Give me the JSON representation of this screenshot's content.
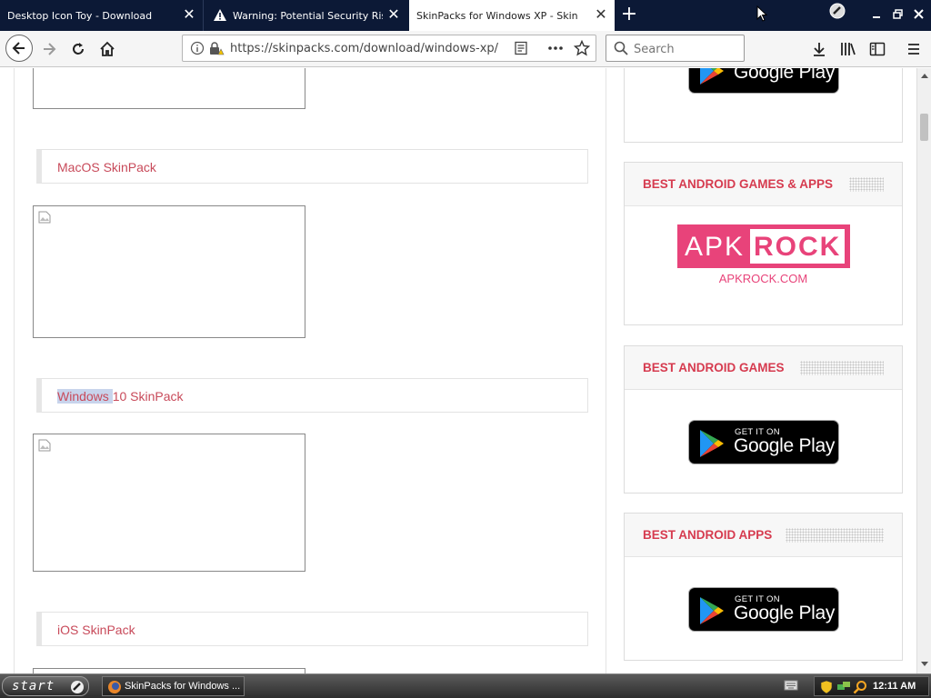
{
  "tabs": [
    {
      "label": "Desktop Icon Toy - Download",
      "active": false
    },
    {
      "label": "Warning: Potential Security Risk Ahead",
      "active": false
    },
    {
      "label": "SkinPacks for Windows XP - Skin Pack for Windows",
      "active": true
    }
  ],
  "nav": {
    "url": "https://skinpacks.com/download/windows-xp/",
    "search_placeholder": "Search"
  },
  "content": {
    "packages": [
      {
        "label": "MacOS SkinPack"
      },
      {
        "label_highlight": "Windows ",
        "label_rest": "10 SkinPack"
      },
      {
        "label": "iOS SkinPack"
      }
    ]
  },
  "widgets": [
    {
      "title": "BEST ANDROID GAMES & APPS",
      "logo_text_apk": "APK",
      "logo_text_rock": "ROCK",
      "url": "APKROCK.COM"
    },
    {
      "title": "BEST ANDROID GAMES"
    },
    {
      "title": "BEST ANDROID APPS"
    }
  ],
  "google_play": {
    "get_it_on": "GET IT ON",
    "store_name": "Google Play"
  },
  "taskbar": {
    "start_label": "start",
    "task_label": "SkinPacks for Windows ...",
    "clock": "12:11 AM"
  },
  "colors": {
    "accent": "#d63b4f",
    "link": "#c84a5a",
    "apk_pink": "#e8437a",
    "tabbar": "#0c1936"
  }
}
